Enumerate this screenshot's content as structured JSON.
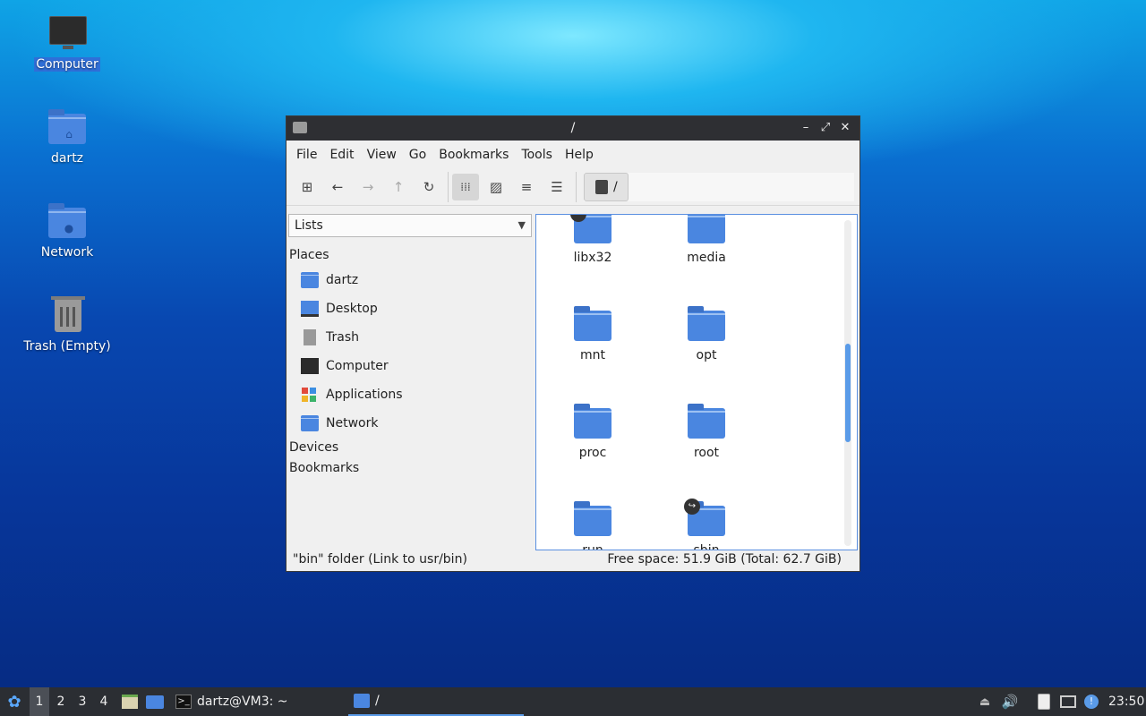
{
  "desktop": {
    "icons": [
      {
        "label": "Computer"
      },
      {
        "label": "dartz"
      },
      {
        "label": "Network"
      },
      {
        "label": "Trash (Empty)"
      }
    ]
  },
  "window": {
    "title": "/",
    "menu": [
      "File",
      "Edit",
      "View",
      "Go",
      "Bookmarks",
      "Tools",
      "Help"
    ],
    "path": "/",
    "side_panel": {
      "mode": "Lists",
      "places_header": "Places",
      "places": [
        "dartz",
        "Desktop",
        "Trash",
        "Computer",
        "Applications",
        "Network"
      ],
      "devices_header": "Devices",
      "bookmarks_header": "Bookmarks"
    },
    "files": [
      {
        "name": "libx32",
        "link": true
      },
      {
        "name": "media",
        "link": false
      },
      {
        "name": "mnt",
        "link": false
      },
      {
        "name": "opt",
        "link": false
      },
      {
        "name": "proc",
        "link": false
      },
      {
        "name": "root",
        "link": false
      },
      {
        "name": "run",
        "link": false
      },
      {
        "name": "sbin",
        "link": true
      }
    ],
    "status_left": "\"bin\" folder (Link to usr/bin)",
    "status_right": "Free space: 51.9 GiB (Total: 62.7 GiB)"
  },
  "taskbar": {
    "workspaces": [
      "1",
      "2",
      "3",
      "4"
    ],
    "tasks": [
      {
        "label": "dartz@VM3: ~"
      },
      {
        "label": "/"
      }
    ],
    "clock": "23:50"
  }
}
